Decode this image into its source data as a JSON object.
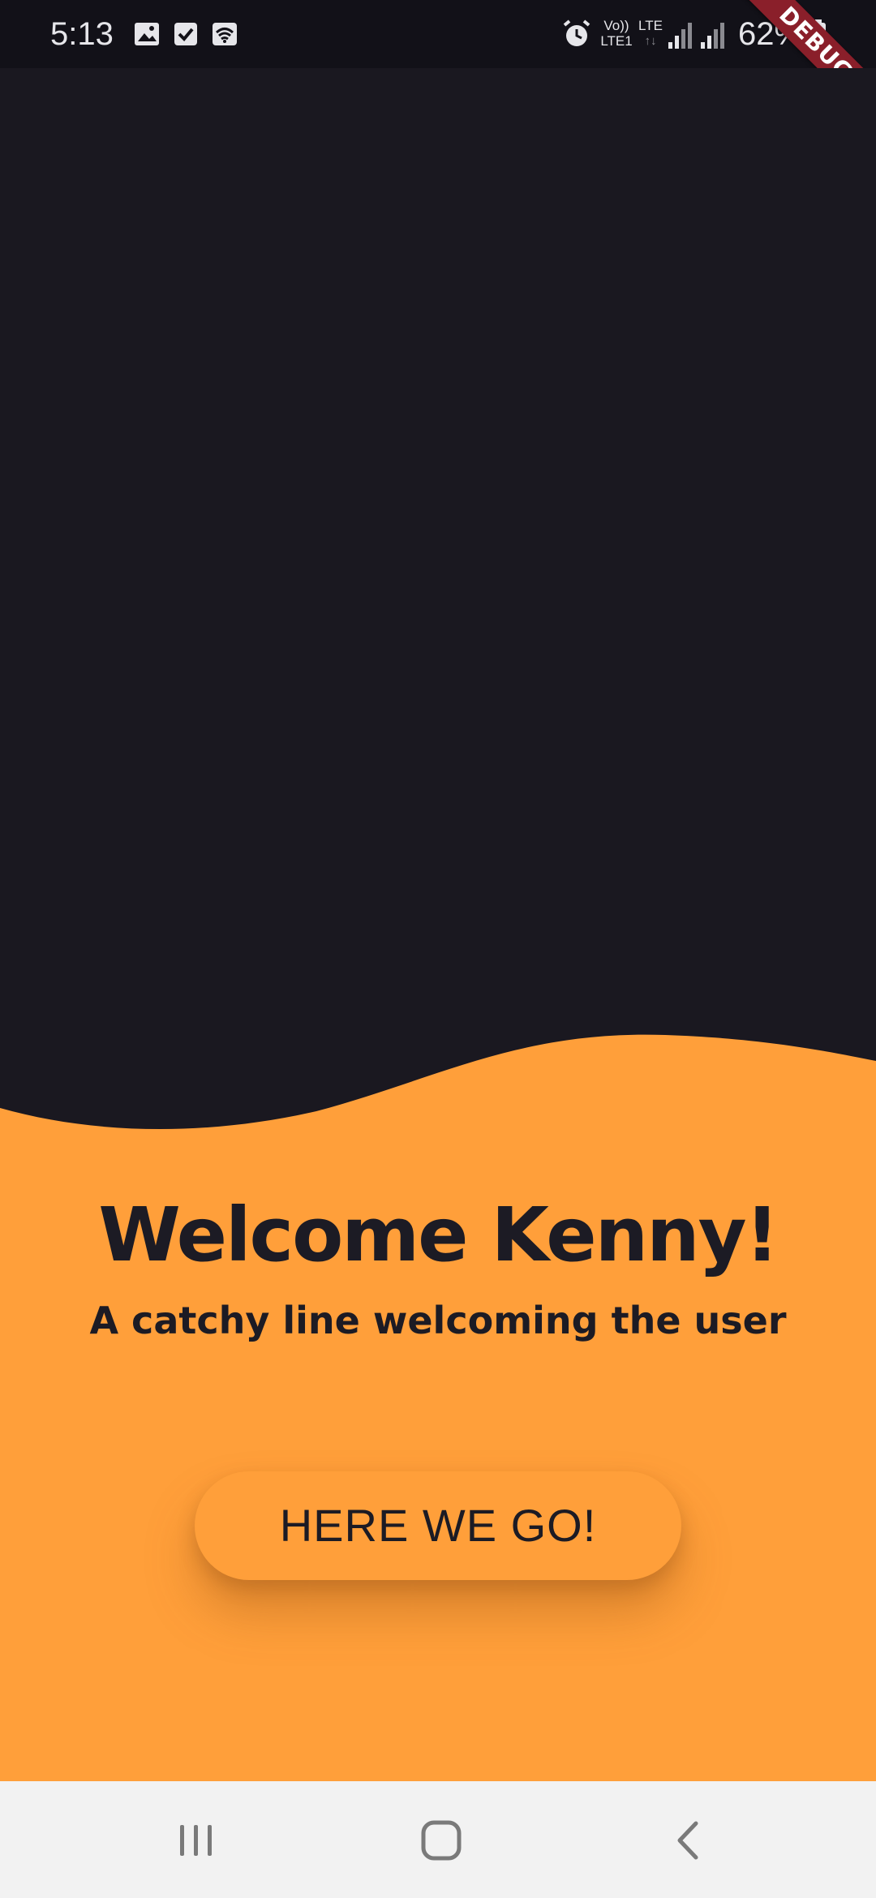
{
  "status_bar": {
    "time": "5:13",
    "battery_text": "62%",
    "icons": [
      "gallery-icon",
      "checkbox-icon",
      "wifi-hotspot-icon",
      "alarm-icon",
      "volte-icon",
      "lte-icon",
      "signal-icon",
      "signal-icon-2",
      "battery-icon"
    ],
    "network_label_1": "Vo))",
    "network_label_2": "LTE1",
    "network_label_3": "LTE"
  },
  "debug_banner": {
    "label": "DEBUG"
  },
  "welcome": {
    "title": "Welcome Kenny!",
    "subtitle": "A catchy line welcoming the user",
    "button_label": "HERE WE GO!"
  },
  "nav_bar": {
    "icons": [
      "recent-apps-icon",
      "home-icon",
      "back-icon"
    ]
  },
  "colors": {
    "background_dark": "#1a1820",
    "accent_orange": "#ff9f3a",
    "text_dark": "#1c1b24",
    "nav_background": "#f2f2f2",
    "debug_red": "#8a1f2a"
  }
}
